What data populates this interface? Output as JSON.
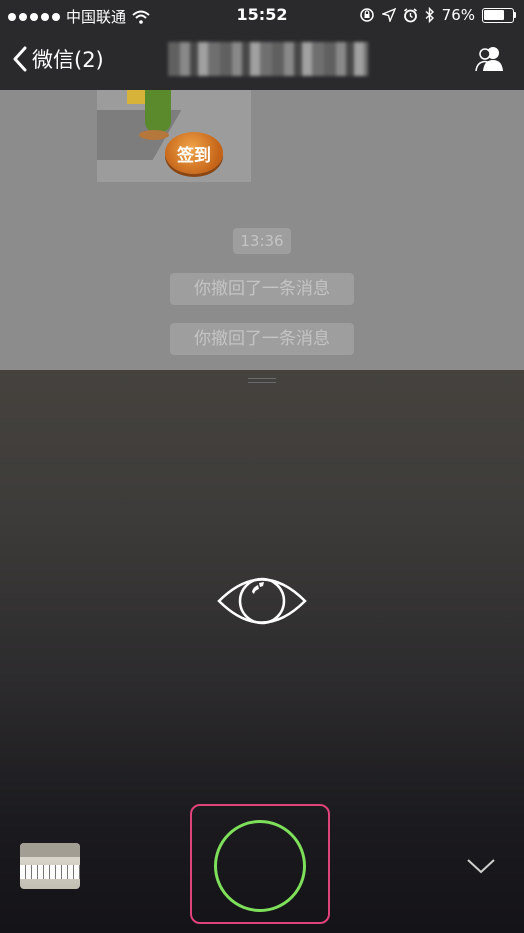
{
  "status_bar": {
    "carrier": "中国联通",
    "time": "15:52",
    "battery": "76%",
    "battery_level": 0.76,
    "icons": [
      "signal-dots",
      "wifi-icon",
      "rotation-lock-icon",
      "location-arrow-icon",
      "alarm-icon",
      "bluetooth-icon",
      "battery-icon"
    ]
  },
  "nav": {
    "back_label": "微信(2)",
    "title_obscured": true,
    "right_icon": "group-members-icon"
  },
  "chat": {
    "sticker_text": "签到",
    "time_label": "13:36",
    "notices": [
      "你撤回了一条消息",
      "你撤回了一条消息"
    ]
  },
  "camera": {
    "center_icon": "eye-icon",
    "left_icon": "gallery-thumbnail",
    "capture_ring_color": "#7ee05a",
    "highlight_color": "#e0437a",
    "right_icon": "chevron-down-icon"
  }
}
